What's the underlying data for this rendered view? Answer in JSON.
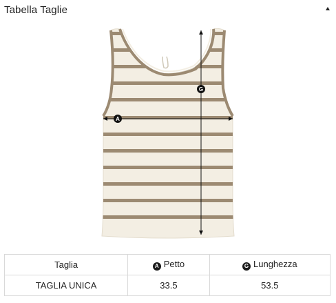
{
  "header": {
    "title": "Tabella Taglie",
    "toggle_icon": "collapse-caret-up-icon"
  },
  "illustration": {
    "marker_a": "A",
    "marker_g": "G",
    "garment_color": "#f3eee3",
    "stripe_color": "#9c8a72",
    "line_color": "#111111"
  },
  "table": {
    "headers": [
      {
        "label": "Taglia",
        "badge": ""
      },
      {
        "label": "Petto",
        "badge": "A"
      },
      {
        "label": "Lunghezza",
        "badge": "G"
      }
    ],
    "rows": [
      [
        "TAGLIA UNICA",
        "33.5",
        "53.5"
      ]
    ]
  }
}
